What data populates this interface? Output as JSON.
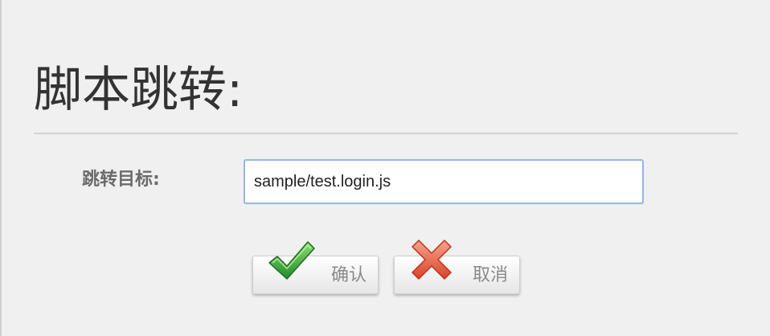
{
  "dialog": {
    "title": "脚本跳转:",
    "field": {
      "label": "跳转目标:",
      "value": "sample/test.login.js"
    },
    "buttons": {
      "confirm_label": "确认",
      "cancel_label": "取消"
    },
    "icons": {
      "confirm": "checkmark-icon",
      "cancel": "cross-icon"
    },
    "colors": {
      "confirm_icon": "#3cb043",
      "cancel_icon": "#e8684a",
      "input_border": "#93b6e8"
    }
  }
}
